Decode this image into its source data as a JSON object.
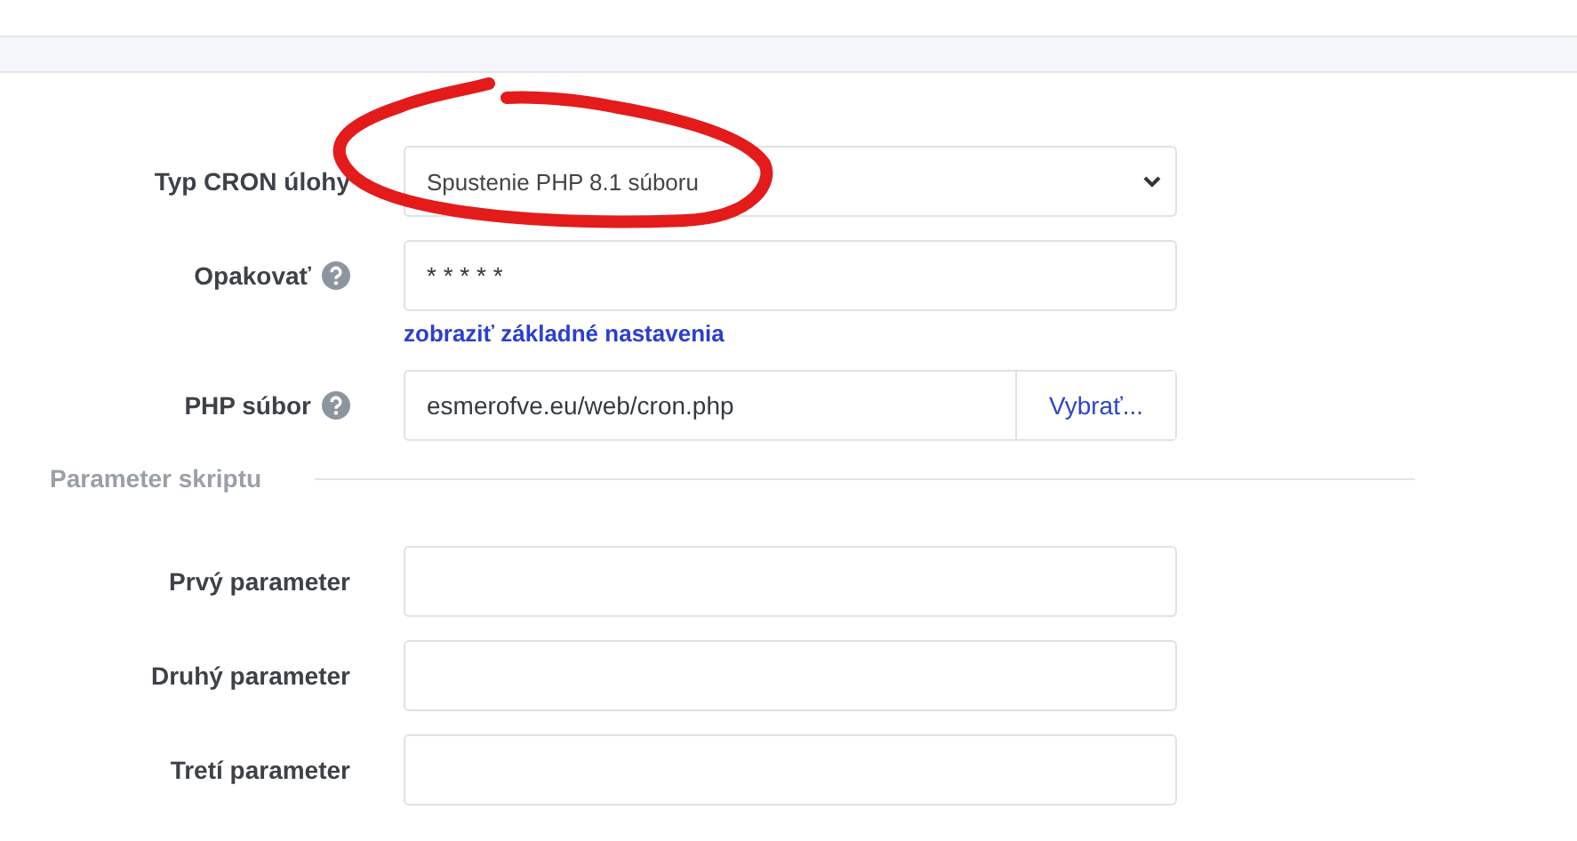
{
  "task_fields": [
    {
      "kind": "select",
      "label": "Typ CRON úlohy",
      "help": false,
      "value": "Spustenie PHP 8.1 súboru"
    },
    {
      "kind": "text",
      "label": "Opakovať",
      "help": true,
      "value": "* * * * *",
      "link": "zobraziť základné nastavenia"
    },
    {
      "kind": "file",
      "label": "PHP súbor",
      "help": true,
      "value": "esmerofve.eu/web/cron.php",
      "button": "Vybrať..."
    }
  ],
  "section": {
    "title": "Parameter skriptu"
  },
  "parameters": [
    {
      "kind": "text",
      "label": "Prvý parameter",
      "help": false
    },
    {
      "kind": "text",
      "label": "Druhý parameter",
      "help": false
    },
    {
      "kind": "text",
      "label": "Tretí parameter",
      "help": false
    }
  ]
}
